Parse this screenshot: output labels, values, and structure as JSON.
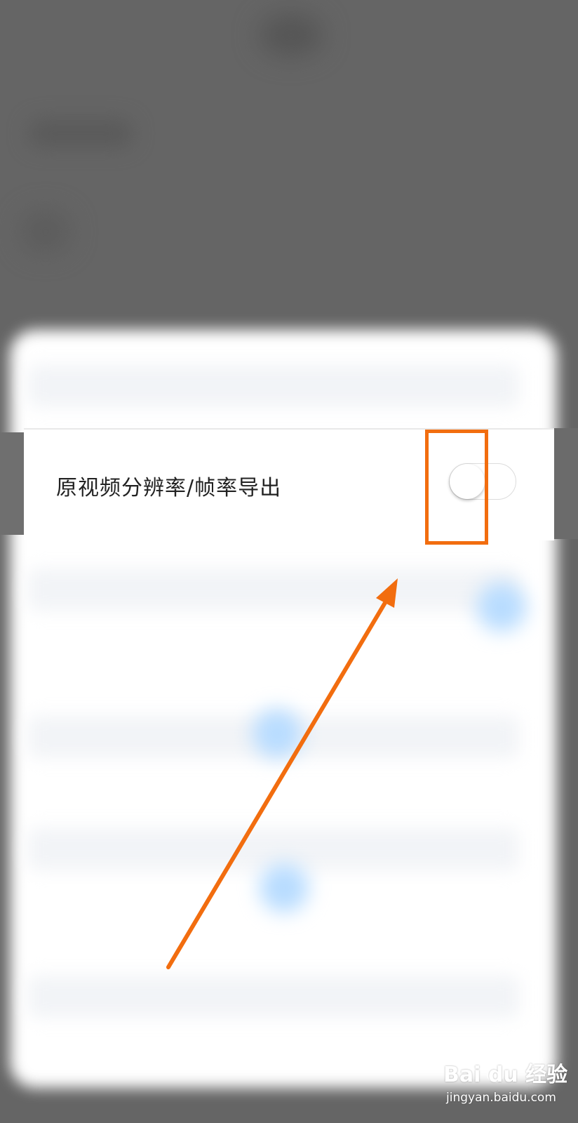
{
  "setting": {
    "label": "原视频分辨率/帧率导出",
    "toggle_state": "off"
  },
  "watermark": {
    "logo": "Bai du 经验",
    "url": "jingyan.baidu.com"
  },
  "colors": {
    "annotation": "#f26d0f",
    "overlay": "#666666",
    "toggle_off": "#ffffff"
  },
  "icons": {
    "arrow": "annotation-arrow-icon",
    "paw": "baidu-paw-icon"
  }
}
